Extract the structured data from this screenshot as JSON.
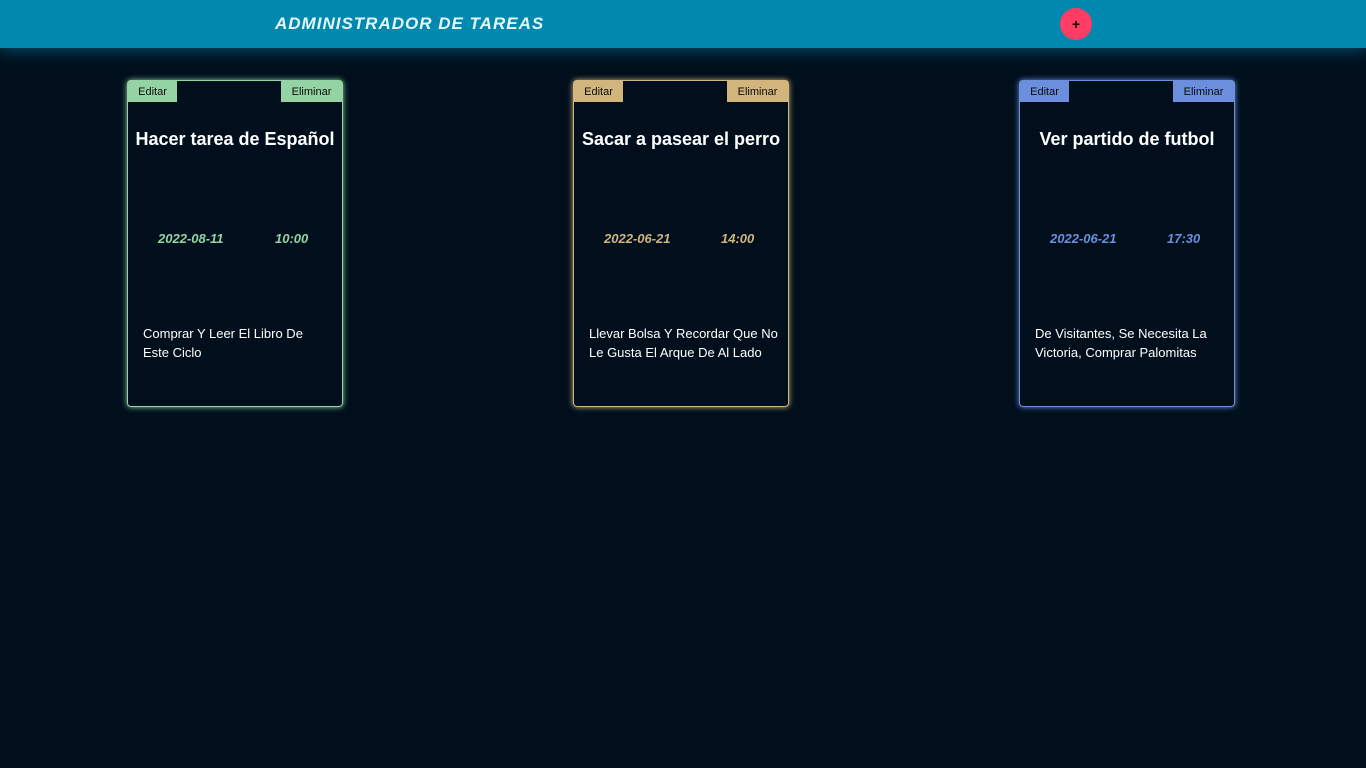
{
  "header": {
    "title": "ADMINISTRADOR DE TAREAS",
    "add_label": "+"
  },
  "colors": {
    "background": "#010f1d",
    "header": "#0088ae",
    "add_button": "#ff3d64"
  },
  "tasks": [
    {
      "edit_label": "Editar",
      "delete_label": "Eliminar",
      "title": "Hacer tarea de Español",
      "date": "2022-08-11",
      "time": "10:00",
      "description": "Comprar Y Leer El Libro De Este Ciclo",
      "color": "#94d4a4"
    },
    {
      "edit_label": "Editar",
      "delete_label": "Eliminar",
      "title": "Sacar a pasear el perro",
      "date": "2022-06-21",
      "time": "14:00",
      "description": "Llevar Bolsa Y Recordar Que No Le Gusta El Arque De Al Lado",
      "color": "#d1b57c"
    },
    {
      "edit_label": "Editar",
      "delete_label": "Eliminar",
      "title": "Ver partido de futbol",
      "date": "2022-06-21",
      "time": "17:30",
      "description": "De Visitantes, Se Necesita La Victoria, Comprar Palomitas",
      "color": "#6b8fdc"
    }
  ]
}
